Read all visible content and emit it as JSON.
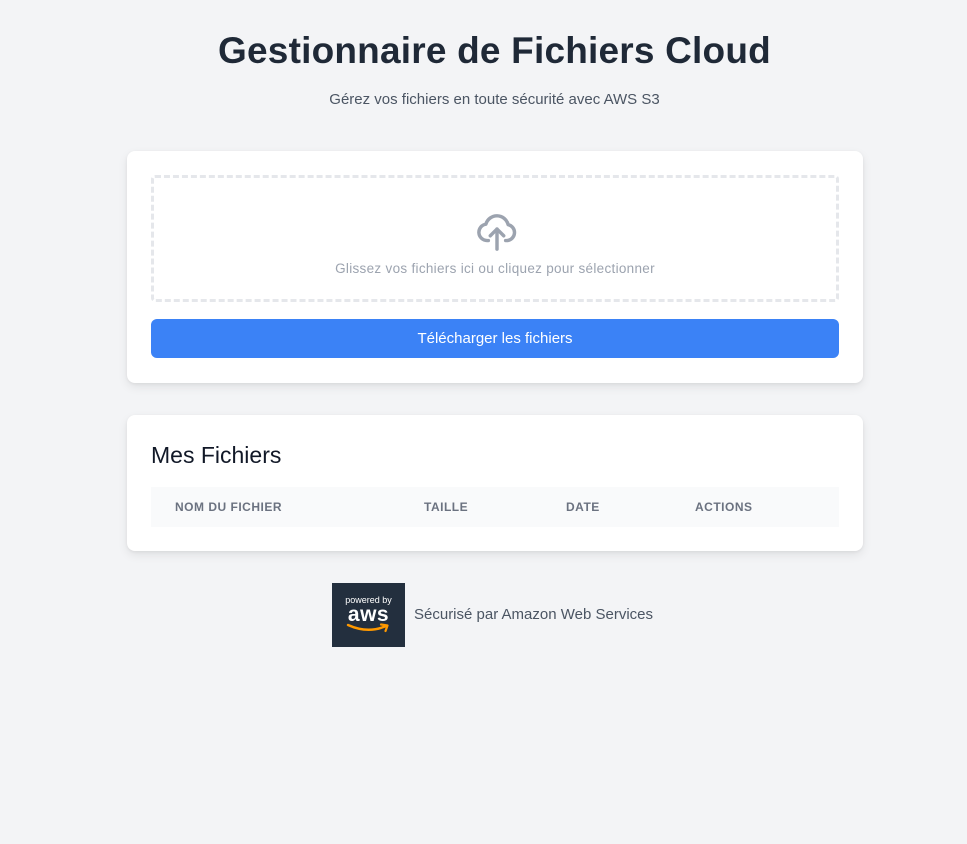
{
  "header": {
    "title": "Gestionnaire de Fichiers Cloud",
    "subtitle": "Gérez vos fichiers en toute sécurité avec AWS S3"
  },
  "upload": {
    "icon": "cloud-upload-icon",
    "dropzone_text": "Glissez vos fichiers ici ou cliquez pour sélectionner",
    "button_label": "Télécharger les fichiers"
  },
  "files": {
    "title": "Mes Fichiers",
    "columns": [
      "NOM DU FICHIER",
      "TAILLE",
      "DATE",
      "ACTIONS"
    ],
    "rows": []
  },
  "footer": {
    "logo": {
      "powered_by": "powered by",
      "brand": "aws"
    },
    "text": "Sécurisé par Amazon Web Services"
  },
  "colors": {
    "background": "#f3f4f6",
    "primary_button": "#3b82f6",
    "aws_dark": "#232f3e",
    "aws_orange": "#ff9900"
  }
}
